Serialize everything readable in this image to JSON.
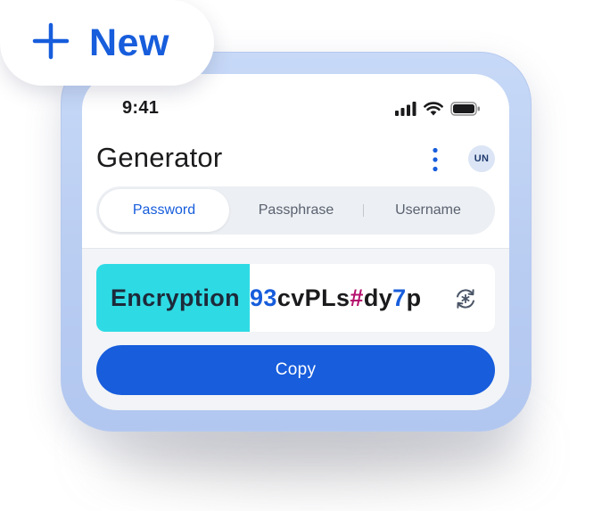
{
  "badge": {
    "icon": "plus-icon",
    "label": "New",
    "accent": "#175ddc"
  },
  "status_bar": {
    "time": "9:41",
    "icons": [
      "signal-icon",
      "wifi-icon",
      "battery-icon"
    ]
  },
  "header": {
    "title": "Generator",
    "menu_icon": "kebab-menu-icon",
    "avatar_initials": "UN"
  },
  "tabs": [
    {
      "label": "Password",
      "active": true
    },
    {
      "label": "Passphrase",
      "active": false
    },
    {
      "label": "Username",
      "active": false
    }
  ],
  "generated": {
    "highlighted_word": "Encryption",
    "parts": [
      {
        "text": "93",
        "kind": "number"
      },
      {
        "text": "cvPLs",
        "kind": "letter"
      },
      {
        "text": "#",
        "kind": "symbol"
      },
      {
        "text": "dy",
        "kind": "letter"
      },
      {
        "text": "7",
        "kind": "number"
      },
      {
        "text": "p",
        "kind": "letter"
      }
    ],
    "regenerate_icon": "regenerate-icon",
    "colors": {
      "highlight": "#2edbe4",
      "number": "#175ddc",
      "symbol": "#b5106e"
    }
  },
  "actions": {
    "copy_label": "Copy"
  }
}
